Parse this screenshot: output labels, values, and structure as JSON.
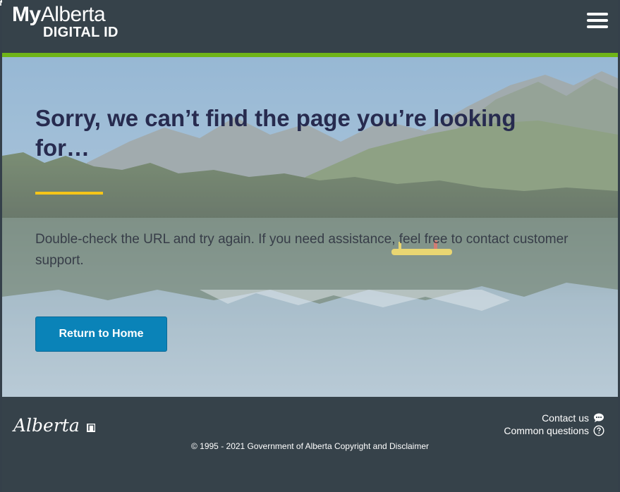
{
  "header": {
    "logo_my": "My",
    "logo_alberta": "Alberta",
    "logo_digital_id": "DIGITAL ID",
    "menu_icon": "hamburger-menu-icon"
  },
  "hero": {
    "title": "Sorry, we can’t find the page you’re looking for…",
    "message": "Double-check the URL and try again. If you need assistance, feel free to contact customer support.",
    "button_label": "Return to Home"
  },
  "footer": {
    "brand": "Alberta",
    "contact_label": "Contact us",
    "contact_icon": "chat-bubble-icon",
    "questions_label": "Common questions",
    "questions_icon": "question-circle-icon",
    "copyright": "© 1995 - 2021 Government of Alberta Copyright and Disclaimer"
  },
  "colors": {
    "header_bg": "#36424a",
    "accent_green": "#6fb418",
    "accent_yellow": "#f5c518",
    "button_blue": "#0a83b8",
    "title_color": "#272b4f"
  }
}
